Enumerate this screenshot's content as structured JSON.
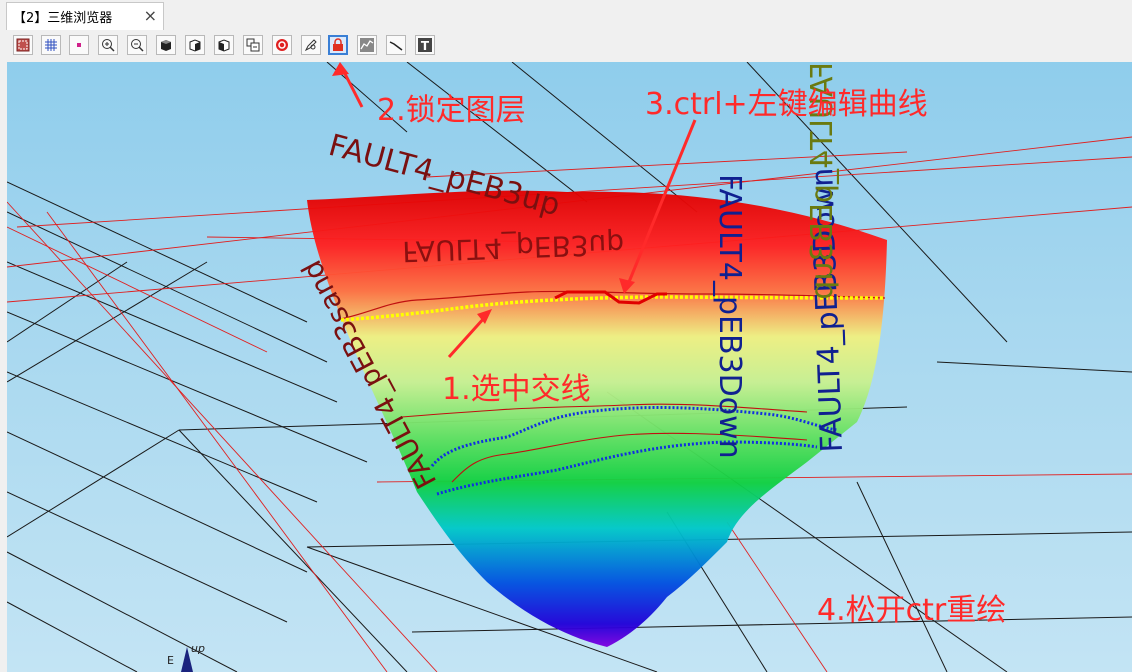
{
  "tab": {
    "title": "【2】三维浏览器",
    "close_glyph": "×"
  },
  "toolbar": {
    "buttons": [
      {
        "name": "select-region-button",
        "icon": "select-region-icon"
      },
      {
        "name": "grid-button",
        "icon": "grid-icon"
      },
      {
        "name": "point-button",
        "icon": "point-icon"
      },
      {
        "name": "zoom-in-button",
        "icon": "zoom-in-icon"
      },
      {
        "name": "zoom-out-button",
        "icon": "zoom-out-icon"
      },
      {
        "name": "cube-front-button",
        "icon": "cube-icon"
      },
      {
        "name": "cube-side-button",
        "icon": "cube-side-icon"
      },
      {
        "name": "cube-top-button",
        "icon": "cube-top-icon"
      },
      {
        "name": "layer-button",
        "icon": "layer-icon"
      },
      {
        "name": "stop-button",
        "icon": "stop-icon"
      },
      {
        "name": "pen-button",
        "icon": "pen-icon"
      },
      {
        "name": "lock-layer-button",
        "icon": "lock-icon",
        "active": true
      },
      {
        "name": "curve-button",
        "icon": "curve-icon"
      },
      {
        "name": "line-button",
        "icon": "line-icon"
      },
      {
        "name": "text-button",
        "icon": "text-icon"
      }
    ]
  },
  "scene": {
    "labels": {
      "top_left": "FAULT4_pEB3up",
      "left_curved": "FAULT4_pEB3sand",
      "left_lower": "FAULT4_pEB3up",
      "center_vertical": "FAULT4_pEB3Down",
      "right_vertical": "FAULT4_pEB3Down",
      "far_right": "FAULT4_pEB3up"
    },
    "axis": {
      "up": "up",
      "east": "E"
    },
    "colors": {
      "annotation": "#ff2a2a",
      "selected_line": "#ffee00",
      "edited_line": "#e00000",
      "blue_line": "#1030e0"
    }
  },
  "annotations": {
    "step1": "1.选中交线",
    "step2": "2.锁定图层",
    "step3": "3.ctrl+左键编辑曲线",
    "step4": "4.松开ctr重绘"
  }
}
